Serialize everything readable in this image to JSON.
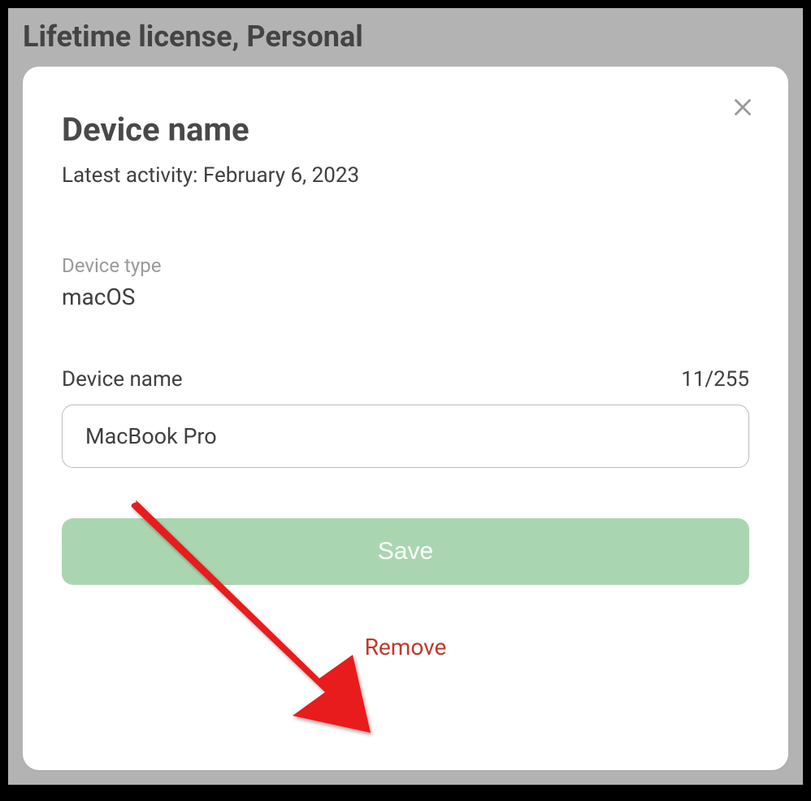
{
  "page": {
    "title": "Lifetime license, Personal"
  },
  "modal": {
    "title": "Device name",
    "activity_prefix": "Latest activity: ",
    "activity_date": "February 6, 2023",
    "device_type_label": "Device type",
    "device_type_value": "macOS",
    "device_name_label": "Device name",
    "device_name_value": "MacBook Pro",
    "char_count": "11/255",
    "save_label": "Save",
    "remove_label": "Remove"
  }
}
